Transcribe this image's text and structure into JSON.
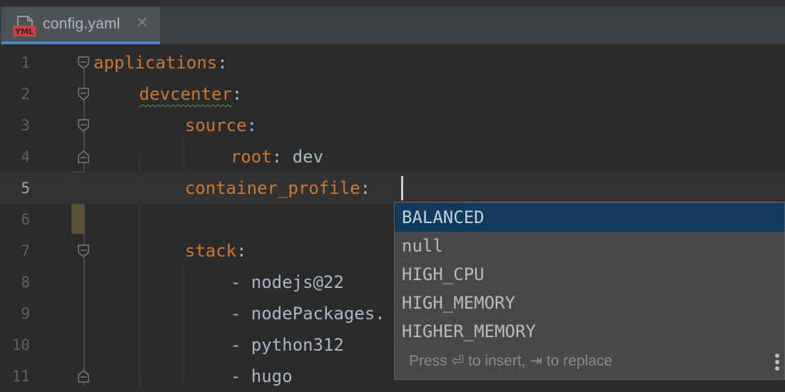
{
  "tab": {
    "icon_text": "YML",
    "filename": "config.yaml",
    "close_glyph": "✕"
  },
  "editor": {
    "lines": [
      {
        "num": "1",
        "key": "applications",
        "colon": ":"
      },
      {
        "num": "2",
        "key": "devcenter",
        "colon": ":"
      },
      {
        "num": "3",
        "key": "source",
        "colon": ":"
      },
      {
        "num": "4",
        "key": "root",
        "colon": ":",
        "value": " dev"
      },
      {
        "num": "5",
        "key": "container_profile",
        "colon": ": "
      },
      {
        "num": "6"
      },
      {
        "num": "7",
        "key": "stack",
        "colon": ":"
      },
      {
        "num": "8",
        "dash": "- ",
        "value": "nodejs@22"
      },
      {
        "num": "9",
        "dash": "- ",
        "value": "nodePackages."
      },
      {
        "num": "10",
        "dash": "- ",
        "value": "python312"
      },
      {
        "num": "11",
        "dash": "- ",
        "value": "hugo"
      }
    ]
  },
  "completion": {
    "items": [
      "BALANCED",
      "null",
      "HIGH_CPU",
      "HIGH_MEMORY",
      "HIGHER_MEMORY"
    ],
    "selected": "BALANCED",
    "hint": {
      "press": "Press",
      "enter_glyph": "⏎",
      "insert": "to insert,",
      "tab_glyph": "⇥",
      "replace": "to replace"
    }
  },
  "colors": {
    "key": "#cc7832",
    "value": "#a9b7c6",
    "selection": "#113a5c",
    "accent": "#4a88c7"
  },
  "icons": [
    "yaml-file-icon",
    "close-icon",
    "fold-icon",
    "more-options-icon"
  ]
}
